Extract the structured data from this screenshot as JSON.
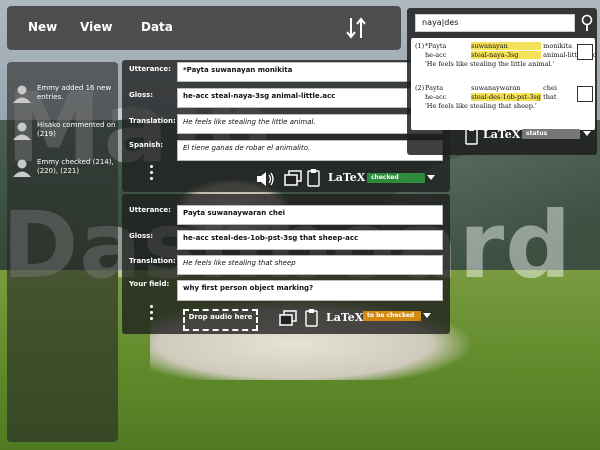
{
  "topbar": {
    "new_label": "New",
    "view_label": "View",
    "data_label": "Data",
    "sort_icon": "sort-arrows-icon"
  },
  "watermark": {
    "line1": "Main",
    "line2": "Dashboard"
  },
  "activity": [
    {
      "text": "Emmy added 16 new entries.",
      "icon": "user-icon"
    },
    {
      "text": "Hisako commented on (219)",
      "icon": "user-icon"
    },
    {
      "text": "Emmy checked (214), (220), (221)",
      "icon": "user-icon"
    }
  ],
  "entry1": {
    "labels": {
      "utterance": "Utterance:",
      "gloss": "Gloss:",
      "translation": "Translation:",
      "spanish": "Spanish:"
    },
    "utterance": "*Payta suwanayan monikita",
    "gloss": "he-acc steal-naya-3sg animal-little.acc",
    "translation": "He feels like stealing the little animal.",
    "spanish": "El tiene ganas de robar el animalito.",
    "latex_label": "LaTeX",
    "status": "checked"
  },
  "entry2": {
    "labels": {
      "utterance": "Utterance:",
      "gloss": "Gloss:",
      "translation": "Translation:",
      "custom": "Your field:"
    },
    "utterance": "Payta suwanaywaran chei",
    "gloss": "he-acc steal-des-1ob-pst-3sg that sheep-acc",
    "translation": "He feels like stealing that sheep",
    "custom": "why first person object marking?",
    "drop_label": "Drop audio here",
    "latex_label": "LaTeX",
    "status": "to be checked"
  },
  "search": {
    "value": "naya|des",
    "results": [
      {
        "num": "(1)",
        "line1": [
          "*Payta",
          "suwanayan",
          "monikita"
        ],
        "line1_hl": "naya",
        "line2": [
          "he-acc",
          "steal-naya-3sg",
          "animal-little.acc"
        ],
        "line2_hl": "naya",
        "line3": "'He feels like stealing the little animal.'"
      },
      {
        "num": "(2)",
        "line1": [
          "Payta",
          "suwanaywaran",
          "chei"
        ],
        "line2": [
          "he-acc",
          "steal-des-1ob-pst-3sg",
          "that"
        ],
        "line2_hl": "des",
        "line3": "'He feels like stealing that sheep.'"
      }
    ],
    "latex_label": "LaTeX",
    "status": "status"
  },
  "colors": {
    "checked": "#2e8b3b",
    "todo": "#d58a14",
    "panel": "#2a2a2a",
    "highlight": "#f5e25a"
  }
}
